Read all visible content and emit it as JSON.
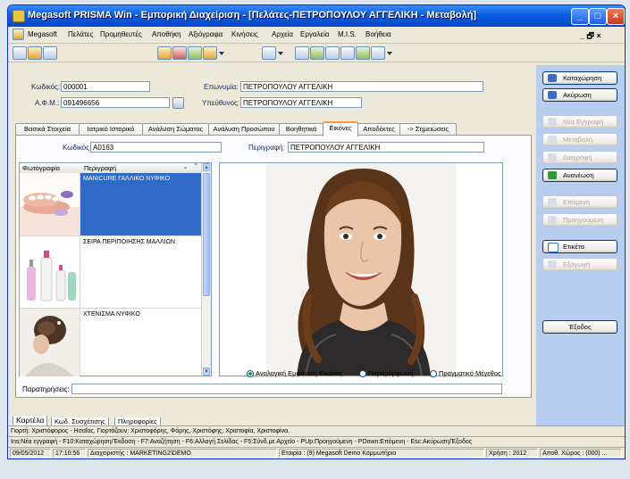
{
  "window": {
    "title": "Megasoft PRISMA Win - Εμπορική Διαχείριση - [Πελάτες-ΠΕΤΡΟΠΟΥΛΟΥ ΑΓΓΕΛΙΚΗ - Μεταβολή]",
    "mdi_controls": "_ 🗗 ×"
  },
  "menu": [
    "Megasoft",
    "Πελάτες",
    "Προμηθευτές",
    "Αποθήκη",
    "Αξιόγραφα",
    "Κινήσεις",
    "Αρχεία",
    "Εργαλεία",
    "M.I.S.",
    "Βοήθεια"
  ],
  "header": {
    "code_label": "Κωδικός:",
    "code_value": "000001",
    "afm_label": "Α.Φ.Μ.:",
    "afm_value": "091496656",
    "name_label": "Επωνυμία:",
    "name_value": "ΠΕΤΡΟΠΟΥΛΟΥ ΑΓΓΕΛΙΚΗ",
    "resp_label": "Υπεύθυνος:",
    "resp_value": "ΠΕΤΡΟΠΟΥΛΟΥ ΑΓΓΕΛΙΚΗ"
  },
  "tabs": [
    {
      "label": "Βασικά Στοιχεία",
      "active": false
    },
    {
      "label": "Ιατρικό Ιστορικό",
      "active": false
    },
    {
      "label": "Ανάλυση Σώματος",
      "active": false
    },
    {
      "label": "Ανάλυση Προσώπου",
      "active": false
    },
    {
      "label": "Βοηθητικά",
      "active": false
    },
    {
      "label": "Εικόνες",
      "active": true
    },
    {
      "label": "Αποδέκτες",
      "active": false
    },
    {
      "label": "-> Σημειώσεις",
      "active": false
    }
  ],
  "images_tab": {
    "code_label": "Κωδικός:",
    "code_value": "A0163",
    "desc_label": "Περιγραφή:",
    "desc_value": "ΠΕΤΡΟΠΟΥΛΟΥ ΑΓΓΕΛΙΚΗ",
    "grid_headers": [
      "Φωτογραφία",
      "Περιγραφή"
    ],
    "rows": [
      {
        "description": "MANICURE ΓΑΛΛΙΚΟ ΝΥΦΙΚΟ",
        "selected": true
      },
      {
        "description": "ΣΕΙΡΑ ΠΕΡΙΠΟΙΗΣΗΣ ΜΑΛΛΙΩΝ",
        "selected": false
      },
      {
        "description": "ΧΤΕΝΙΣΜΑ ΝΥΦΙΚΟ",
        "selected": false
      }
    ],
    "radio_options": [
      {
        "label": "Αναλογική Εμφάνιση Εικόνας",
        "checked": true
      },
      {
        "label": "Παραμόρφωση",
        "checked": false
      },
      {
        "label": "Πραγματικό Μέγεθος",
        "checked": false
      }
    ],
    "remarks_label": "Παρατηρήσεις:",
    "remarks_value": ""
  },
  "actions": [
    {
      "label": "Καταχώρηση",
      "enabled": true,
      "color": "#3a6ec8"
    },
    {
      "label": "Ακύρωση",
      "enabled": true,
      "color": "#3a6ec8"
    },
    {
      "label": "Νέα Εγγραφή",
      "enabled": false,
      "color": "#b8c4d8"
    },
    {
      "label": "Μεταβολή",
      "enabled": false,
      "color": "#b8c4d8"
    },
    {
      "label": "Διαγραφή",
      "enabled": false,
      "color": "#b8c4d8"
    },
    {
      "label": "Ανανέωση",
      "enabled": true,
      "color": "#2e9a3a"
    },
    {
      "label": "Επόμενη",
      "enabled": false,
      "color": "#b8c4d8"
    },
    {
      "label": "Προηγούμενη",
      "enabled": false,
      "color": "#b8c4d8"
    },
    {
      "label": "Ετικέτα",
      "enabled": true,
      "color": "#3a6ec8"
    },
    {
      "label": "Εξαγωγή",
      "enabled": false,
      "color": "#b8c4d8"
    },
    {
      "label": "Έξοδος",
      "enabled": true,
      "color": ""
    }
  ],
  "bottom_tabs": [
    "Καρτέλα",
    "Κωδ. Συσχέτισης",
    "Πληροφορίες"
  ],
  "hint_line_1": "Γιορτή: Χριστόφορος - Ησαΐας. Γιορτάζουν: Χριστοφόρης, Φόρης, Χριστόφης, Χριστοφία, Χριστοφίνα.",
  "hint_line_2": "Ins:Νέα εγγραφή - F10:Καταχώρηση/Έκδοση - F7:Αναζήτηση - F6:Αλλαγή Σελίδας - F5:Σύνδ.με Αρχείο - PUp:Προηγούμενη - PDown:Επόμενη - Esc:Ακύρωση/Έξοδος",
  "status": {
    "date": "09/05/2012",
    "time": "17:10:56",
    "admin": "Διαχειριστής : MARKETING2\\DEMO",
    "company": "Εταιρία : (9) Megasoft Demo Κομμωτήριο",
    "year": "Χρήση : 2012",
    "warehouse": "Αποθ. Χώρος : (000) ..."
  }
}
